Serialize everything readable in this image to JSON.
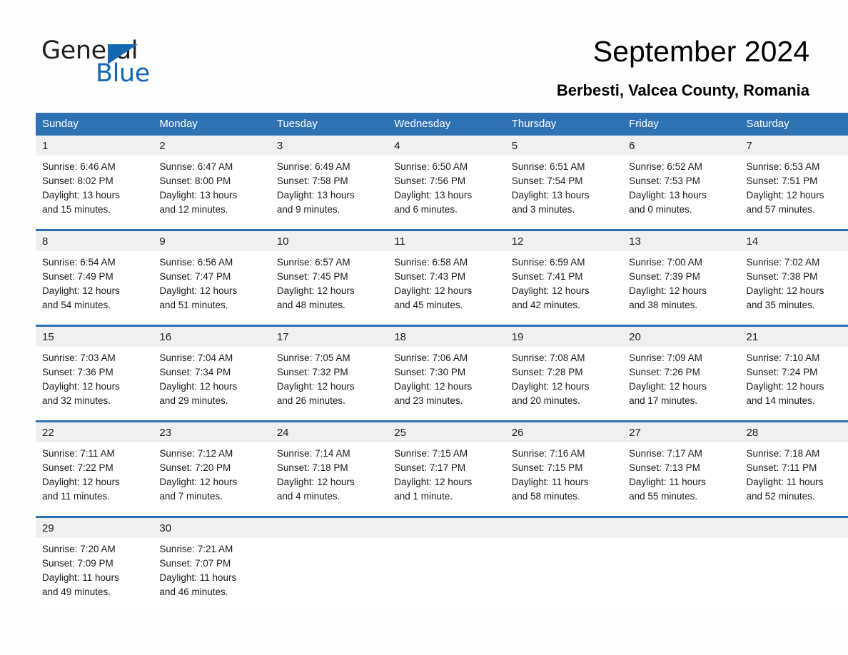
{
  "brand": {
    "name_part1": "General",
    "name_part2": "Blue",
    "accent_color": "#1468b0"
  },
  "header": {
    "title": "September 2024",
    "location": "Berbesti, Valcea County, Romania"
  },
  "theme": {
    "header_bg": "#2f72b4",
    "daynum_bg": "#f0f0f0",
    "page_bg": "#fefefe"
  },
  "weekday_headers": [
    "Sunday",
    "Monday",
    "Tuesday",
    "Wednesday",
    "Thursday",
    "Friday",
    "Saturday"
  ],
  "weeks": [
    [
      {
        "day": "1",
        "sunrise": "Sunrise: 6:46 AM",
        "sunset": "Sunset: 8:02 PM",
        "daylight_line1": "Daylight: 13 hours",
        "daylight_line2": "and 15 minutes."
      },
      {
        "day": "2",
        "sunrise": "Sunrise: 6:47 AM",
        "sunset": "Sunset: 8:00 PM",
        "daylight_line1": "Daylight: 13 hours",
        "daylight_line2": "and 12 minutes."
      },
      {
        "day": "3",
        "sunrise": "Sunrise: 6:49 AM",
        "sunset": "Sunset: 7:58 PM",
        "daylight_line1": "Daylight: 13 hours",
        "daylight_line2": "and 9 minutes."
      },
      {
        "day": "4",
        "sunrise": "Sunrise: 6:50 AM",
        "sunset": "Sunset: 7:56 PM",
        "daylight_line1": "Daylight: 13 hours",
        "daylight_line2": "and 6 minutes."
      },
      {
        "day": "5",
        "sunrise": "Sunrise: 6:51 AM",
        "sunset": "Sunset: 7:54 PM",
        "daylight_line1": "Daylight: 13 hours",
        "daylight_line2": "and 3 minutes."
      },
      {
        "day": "6",
        "sunrise": "Sunrise: 6:52 AM",
        "sunset": "Sunset: 7:53 PM",
        "daylight_line1": "Daylight: 13 hours",
        "daylight_line2": "and 0 minutes."
      },
      {
        "day": "7",
        "sunrise": "Sunrise: 6:53 AM",
        "sunset": "Sunset: 7:51 PM",
        "daylight_line1": "Daylight: 12 hours",
        "daylight_line2": "and 57 minutes."
      }
    ],
    [
      {
        "day": "8",
        "sunrise": "Sunrise: 6:54 AM",
        "sunset": "Sunset: 7:49 PM",
        "daylight_line1": "Daylight: 12 hours",
        "daylight_line2": "and 54 minutes."
      },
      {
        "day": "9",
        "sunrise": "Sunrise: 6:56 AM",
        "sunset": "Sunset: 7:47 PM",
        "daylight_line1": "Daylight: 12 hours",
        "daylight_line2": "and 51 minutes."
      },
      {
        "day": "10",
        "sunrise": "Sunrise: 6:57 AM",
        "sunset": "Sunset: 7:45 PM",
        "daylight_line1": "Daylight: 12 hours",
        "daylight_line2": "and 48 minutes."
      },
      {
        "day": "11",
        "sunrise": "Sunrise: 6:58 AM",
        "sunset": "Sunset: 7:43 PM",
        "daylight_line1": "Daylight: 12 hours",
        "daylight_line2": "and 45 minutes."
      },
      {
        "day": "12",
        "sunrise": "Sunrise: 6:59 AM",
        "sunset": "Sunset: 7:41 PM",
        "daylight_line1": "Daylight: 12 hours",
        "daylight_line2": "and 42 minutes."
      },
      {
        "day": "13",
        "sunrise": "Sunrise: 7:00 AM",
        "sunset": "Sunset: 7:39 PM",
        "daylight_line1": "Daylight: 12 hours",
        "daylight_line2": "and 38 minutes."
      },
      {
        "day": "14",
        "sunrise": "Sunrise: 7:02 AM",
        "sunset": "Sunset: 7:38 PM",
        "daylight_line1": "Daylight: 12 hours",
        "daylight_line2": "and 35 minutes."
      }
    ],
    [
      {
        "day": "15",
        "sunrise": "Sunrise: 7:03 AM",
        "sunset": "Sunset: 7:36 PM",
        "daylight_line1": "Daylight: 12 hours",
        "daylight_line2": "and 32 minutes."
      },
      {
        "day": "16",
        "sunrise": "Sunrise: 7:04 AM",
        "sunset": "Sunset: 7:34 PM",
        "daylight_line1": "Daylight: 12 hours",
        "daylight_line2": "and 29 minutes."
      },
      {
        "day": "17",
        "sunrise": "Sunrise: 7:05 AM",
        "sunset": "Sunset: 7:32 PM",
        "daylight_line1": "Daylight: 12 hours",
        "daylight_line2": "and 26 minutes."
      },
      {
        "day": "18",
        "sunrise": "Sunrise: 7:06 AM",
        "sunset": "Sunset: 7:30 PM",
        "daylight_line1": "Daylight: 12 hours",
        "daylight_line2": "and 23 minutes."
      },
      {
        "day": "19",
        "sunrise": "Sunrise: 7:08 AM",
        "sunset": "Sunset: 7:28 PM",
        "daylight_line1": "Daylight: 12 hours",
        "daylight_line2": "and 20 minutes."
      },
      {
        "day": "20",
        "sunrise": "Sunrise: 7:09 AM",
        "sunset": "Sunset: 7:26 PM",
        "daylight_line1": "Daylight: 12 hours",
        "daylight_line2": "and 17 minutes."
      },
      {
        "day": "21",
        "sunrise": "Sunrise: 7:10 AM",
        "sunset": "Sunset: 7:24 PM",
        "daylight_line1": "Daylight: 12 hours",
        "daylight_line2": "and 14 minutes."
      }
    ],
    [
      {
        "day": "22",
        "sunrise": "Sunrise: 7:11 AM",
        "sunset": "Sunset: 7:22 PM",
        "daylight_line1": "Daylight: 12 hours",
        "daylight_line2": "and 11 minutes."
      },
      {
        "day": "23",
        "sunrise": "Sunrise: 7:12 AM",
        "sunset": "Sunset: 7:20 PM",
        "daylight_line1": "Daylight: 12 hours",
        "daylight_line2": "and 7 minutes."
      },
      {
        "day": "24",
        "sunrise": "Sunrise: 7:14 AM",
        "sunset": "Sunset: 7:18 PM",
        "daylight_line1": "Daylight: 12 hours",
        "daylight_line2": "and 4 minutes."
      },
      {
        "day": "25",
        "sunrise": "Sunrise: 7:15 AM",
        "sunset": "Sunset: 7:17 PM",
        "daylight_line1": "Daylight: 12 hours",
        "daylight_line2": "and 1 minute."
      },
      {
        "day": "26",
        "sunrise": "Sunrise: 7:16 AM",
        "sunset": "Sunset: 7:15 PM",
        "daylight_line1": "Daylight: 11 hours",
        "daylight_line2": "and 58 minutes."
      },
      {
        "day": "27",
        "sunrise": "Sunrise: 7:17 AM",
        "sunset": "Sunset: 7:13 PM",
        "daylight_line1": "Daylight: 11 hours",
        "daylight_line2": "and 55 minutes."
      },
      {
        "day": "28",
        "sunrise": "Sunrise: 7:18 AM",
        "sunset": "Sunset: 7:11 PM",
        "daylight_line1": "Daylight: 11 hours",
        "daylight_line2": "and 52 minutes."
      }
    ],
    [
      {
        "day": "29",
        "sunrise": "Sunrise: 7:20 AM",
        "sunset": "Sunset: 7:09 PM",
        "daylight_line1": "Daylight: 11 hours",
        "daylight_line2": "and 49 minutes."
      },
      {
        "day": "30",
        "sunrise": "Sunrise: 7:21 AM",
        "sunset": "Sunset: 7:07 PM",
        "daylight_line1": "Daylight: 11 hours",
        "daylight_line2": "and 46 minutes."
      },
      {
        "day": "",
        "sunrise": "",
        "sunset": "",
        "daylight_line1": "",
        "daylight_line2": ""
      },
      {
        "day": "",
        "sunrise": "",
        "sunset": "",
        "daylight_line1": "",
        "daylight_line2": ""
      },
      {
        "day": "",
        "sunrise": "",
        "sunset": "",
        "daylight_line1": "",
        "daylight_line2": ""
      },
      {
        "day": "",
        "sunrise": "",
        "sunset": "",
        "daylight_line1": "",
        "daylight_line2": ""
      },
      {
        "day": "",
        "sunrise": "",
        "sunset": "",
        "daylight_line1": "",
        "daylight_line2": ""
      }
    ]
  ]
}
